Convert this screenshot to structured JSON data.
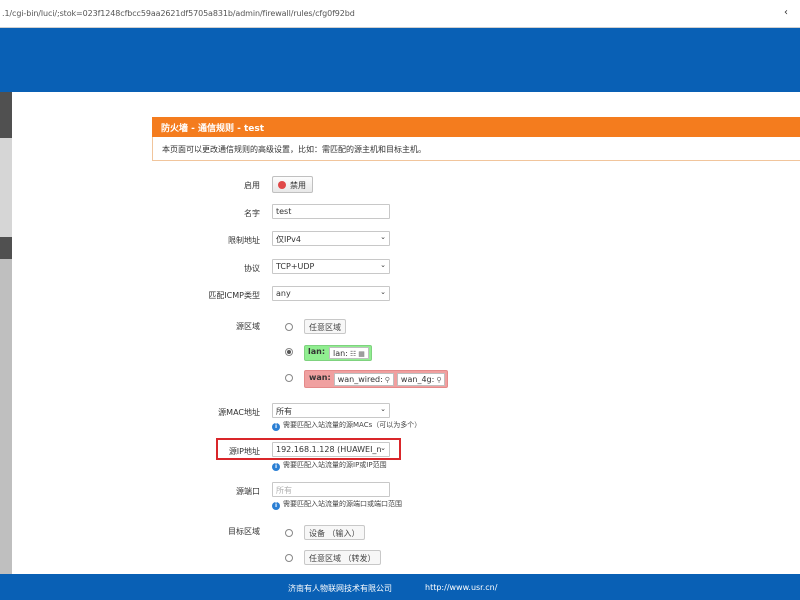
{
  "browser": {
    "url": ".1/cgi-bin/luci/;stok=023f1248cfbcc59aa2621df5705a831b/admin/firewall/rules/cfg0f92bd"
  },
  "colors": {
    "header_blue": "#0960b5",
    "panel_orange": "#f47c1e",
    "lan_green": "#90ee90",
    "wan_red": "#f0a0a0",
    "highlight_red": "#d9262a"
  },
  "panel": {
    "title": "防火墙 - 通信规则 - test",
    "description": "本页面可以更改通信规则的高级设置，比如：需匹配的源主机和目标主机。"
  },
  "form": {
    "enable": {
      "label": "启用",
      "button": "禁用"
    },
    "name": {
      "label": "名字",
      "value": "test"
    },
    "family": {
      "label": "限制地址",
      "value": "仅IPv4"
    },
    "proto": {
      "label": "协议",
      "value": "TCP+UDP"
    },
    "icmp": {
      "label": "匹配ICMP类型",
      "value": "any"
    },
    "src_zone": {
      "label": "源区域",
      "options": {
        "any": "任意区域",
        "lan_name": "lan:",
        "lan_iface": "lan:",
        "wan_name": "wan:",
        "wan_iface1": "wan_wired:",
        "wan_iface2": "wan_4g:"
      },
      "selected": "lan"
    },
    "src_mac": {
      "label": "源MAC地址",
      "value": "所有",
      "hint": "需要匹配入站流量的源MACs（可以为多个）"
    },
    "src_ip": {
      "label": "源IP地址",
      "value": "192.168.1.128 (HUAWEI_n",
      "hint": "需要匹配入站流量的源IP或IP范围"
    },
    "src_port": {
      "label": "源端口",
      "placeholder": "所有",
      "hint": "需要匹配入站流量的源端口或端口范围"
    },
    "dest_zone": {
      "label": "目标区域",
      "options": {
        "device": "设备 （输入）",
        "any": "任意区域 （转发）"
      }
    }
  },
  "footer": {
    "company": "济南有人物联网技术有限公司",
    "url": "http://www.usr.cn/"
  }
}
